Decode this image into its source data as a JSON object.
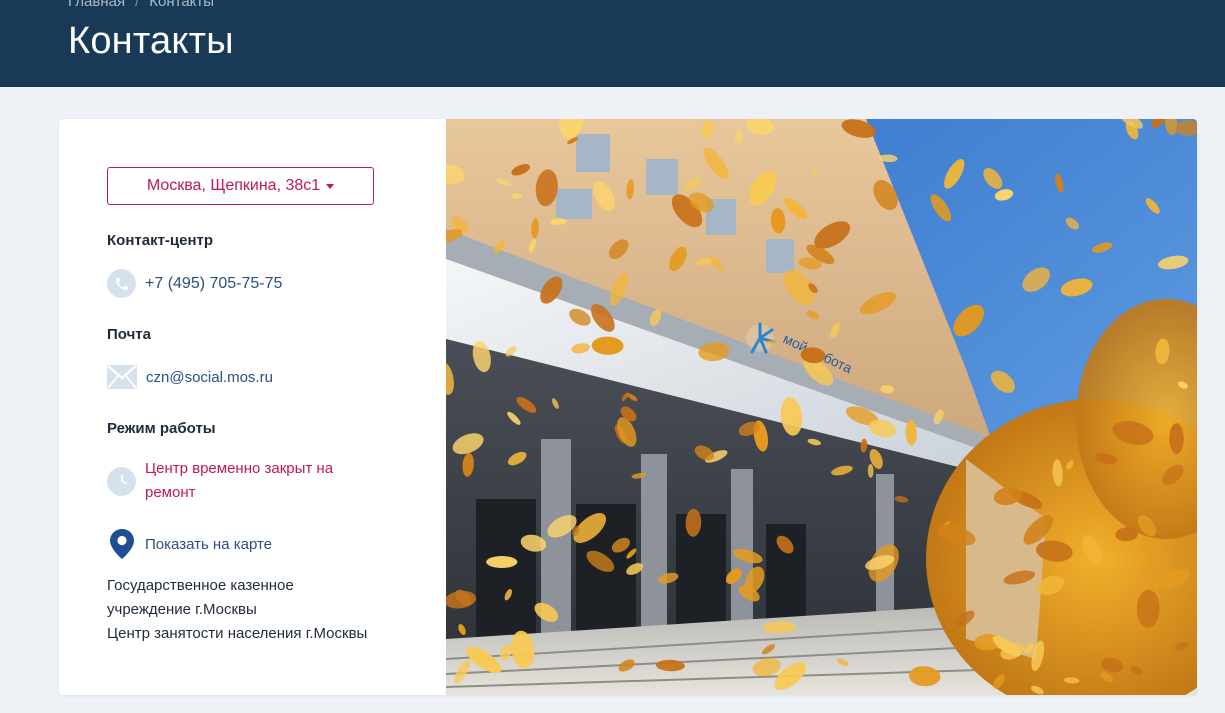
{
  "breadcrumb": {
    "home": "Главная",
    "separator": "/",
    "current": "Контакты"
  },
  "page": {
    "title": "Контакты"
  },
  "contacts": {
    "address_selector": "Москва, Щепкина, 38с1",
    "contact_center_label": "Контакт-центр",
    "phone": "+7 (495) 705-75-75",
    "mail_label": "Почта",
    "email": "czn@social.mos.ru",
    "hours_label": "Режим работы",
    "hours_status": "Центр временно закрыт на ремонт",
    "map_link": "Показать на карте",
    "org_lines": [
      "Государственное казенное",
      "учреждение г.Москвы",
      "Центр занятости населения г.Москвы"
    ]
  },
  "photo": {
    "sign_text": "мой работа"
  },
  "colors": {
    "header_bg": "#183a57",
    "accent_red": "#c2185b",
    "link_blue": "#2b4f86",
    "icon_bg": "#d6e1ee",
    "page_bg": "#eef2f6"
  }
}
